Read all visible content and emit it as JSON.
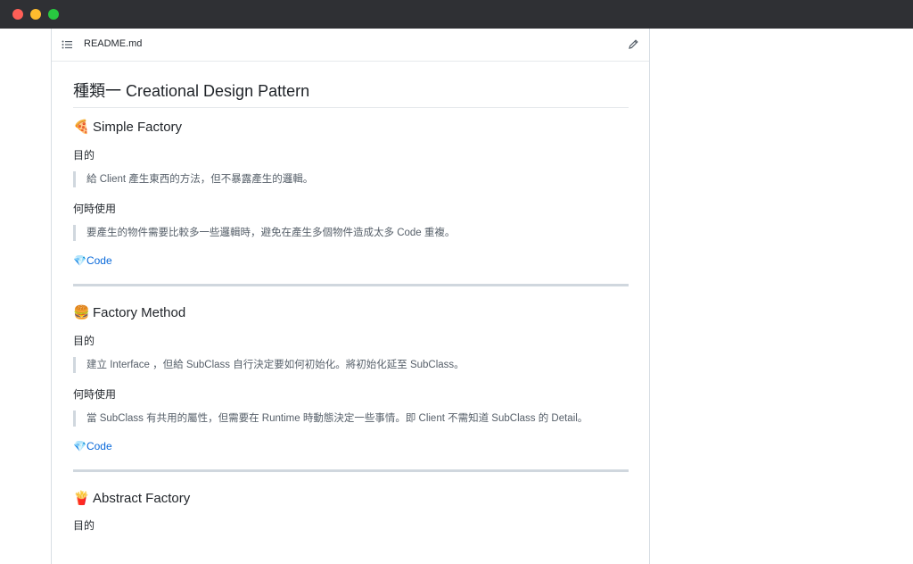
{
  "file": {
    "name": "README.md"
  },
  "heading": "種類一 Creational Design Pattern",
  "sections": [
    {
      "emoji": "🍕",
      "title": "Simple Factory",
      "purpose_label": "目的",
      "purpose": "給 Client 產生東西的方法，但不暴露產生的邏輯。",
      "when_label": "何時使用",
      "when": "要產生的物件需要比較多一些邏輯時，避免在產生多個物件造成太多 Code 重複。",
      "code_emoji": "💎",
      "code_label": "Code"
    },
    {
      "emoji": "🍔",
      "title": "Factory Method",
      "purpose_label": "目的",
      "purpose": "建立 Interface ，但給 SubClass 自行決定要如何初始化。將初始化延至 SubClass。",
      "when_label": "何時使用",
      "when": "當 SubClass 有共用的屬性，但需要在 Runtime 時動態決定一些事情。即 Client 不需知道 SubClass 的 Detail。",
      "code_emoji": "💎",
      "code_label": "Code"
    },
    {
      "emoji": "🍟",
      "title": "Abstract Factory",
      "purpose_label": "目的"
    }
  ],
  "colors": {
    "titlebar": "#2f3034",
    "link": "#0969da",
    "quote_bar": "#d0d7de"
  }
}
